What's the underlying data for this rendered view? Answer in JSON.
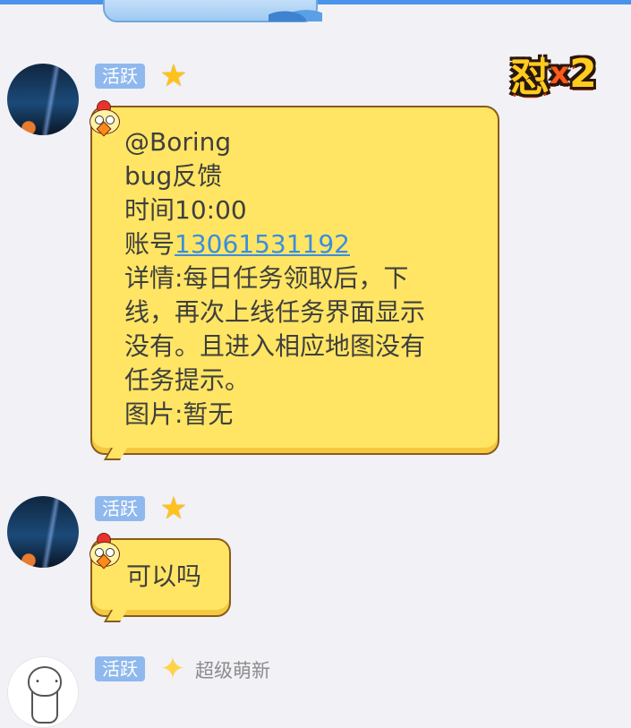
{
  "chat": {
    "messages": [
      {
        "badge": "活跃",
        "lines": [
          "@Boring",
          "bug反馈",
          "时间10:00"
        ],
        "account_prefix": "账号",
        "account_link": "13061531192",
        "details": [
          "详情:每日任务领取后，下",
          "线，再次上线任务界面显示",
          "没有。且进入相应地图没有",
          "任务提示。",
          "图片:暂无"
        ]
      },
      {
        "badge": "活跃",
        "text": "可以吗"
      },
      {
        "badge": "活跃",
        "nickname": "超级萌新"
      }
    ],
    "combo_badge": {
      "glyph": "怼",
      "multiplier": "x",
      "count": "2"
    }
  },
  "colors": {
    "bubble": "#ffe563",
    "bubble_border": "#8a5a1c",
    "active_tag": "#8fb9ee",
    "link": "#3b8de0",
    "background": "#f1f1f6"
  },
  "icons": {
    "level_icon": "star-icon",
    "level_icon_alt": "diamond-icon",
    "bubble_decor": "chick-icon"
  }
}
